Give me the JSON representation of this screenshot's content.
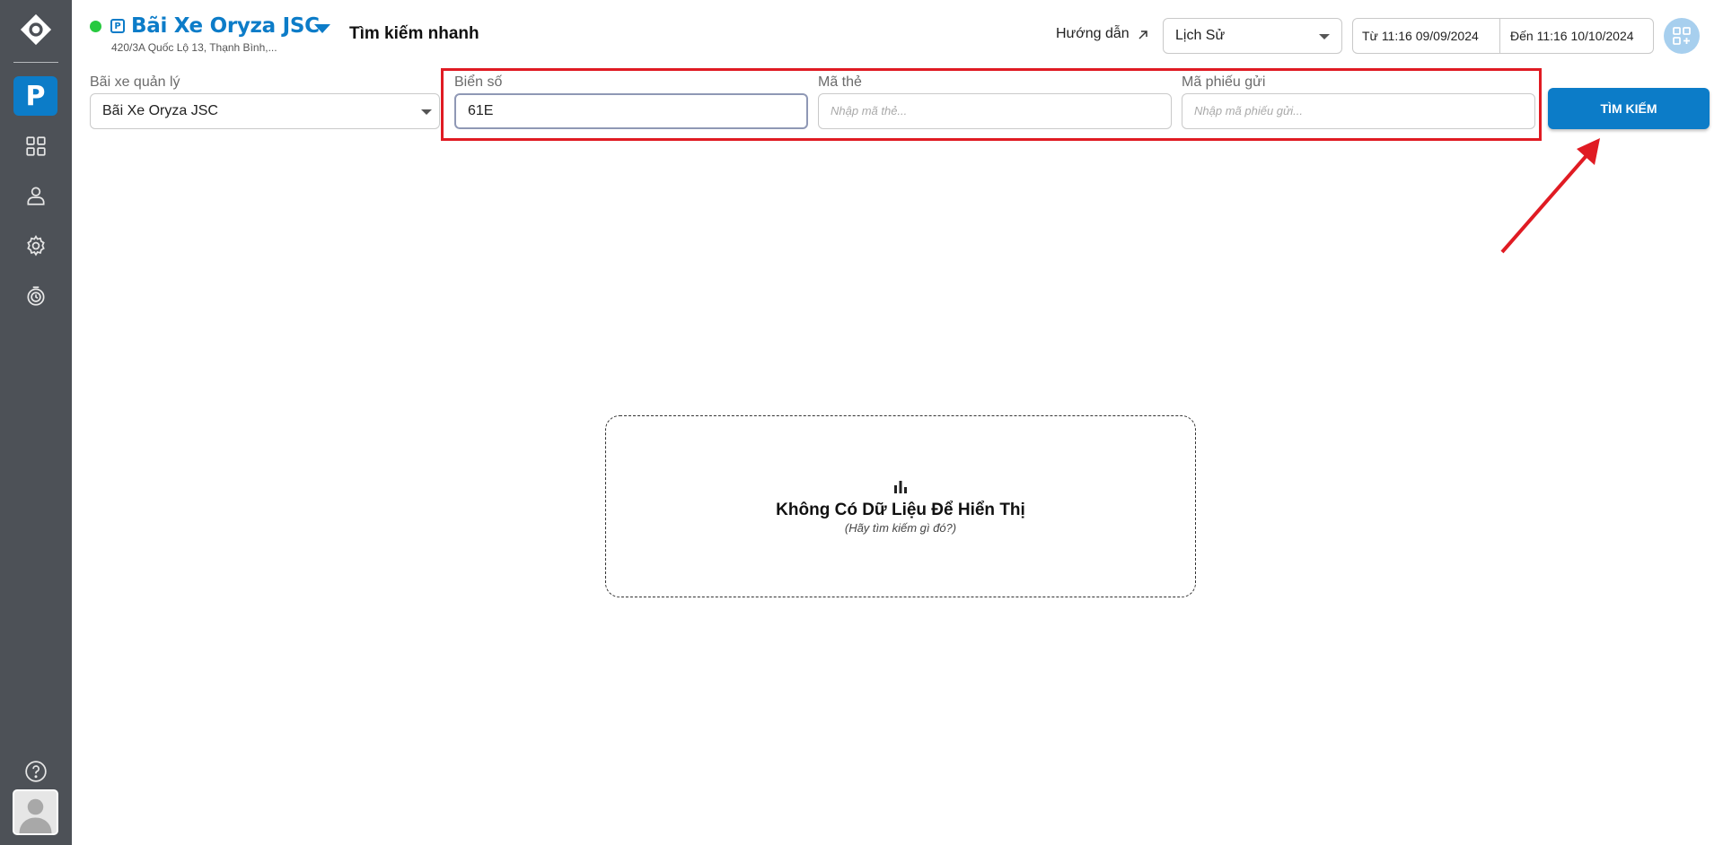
{
  "sidebar": {
    "logo": "logo-icon",
    "active_item": "P",
    "items": [
      "dashboard-grid-icon",
      "user-icon",
      "settings-gear-icon",
      "history-clock-icon"
    ],
    "help": "help-icon",
    "avatar": "avatar-icon"
  },
  "header": {
    "lot_name": "Bãi Xe Oryza JSC",
    "lot_address": "420/3A Quốc Lộ 13, Thạnh Bình,...",
    "page_title": "Tìm kiếm nhanh",
    "guide_label": "Hướng dẫn",
    "mode_select": "Lịch Sử",
    "date_from": "Từ 11:16 09/09/2024",
    "date_to": "Đến 11:16 10/10/2024"
  },
  "filters": {
    "lot_label": "Bãi xe quản lý",
    "lot_value": "Bãi Xe Oryza JSC",
    "plate_label": "Biển số",
    "plate_value": "61E",
    "card_label": "Mã thẻ",
    "card_placeholder": "Nhập mã thẻ...",
    "ticket_label": "Mã phiếu gửi",
    "ticket_placeholder": "Nhập mã phiếu gửi...",
    "search_button": "TÌM KIẾM"
  },
  "empty_state": {
    "title": "Không Có Dữ Liệu Để Hiển Thị",
    "subtitle": "(Hãy tìm kiếm gì đó?)"
  },
  "colors": {
    "accent": "#0c7cc8",
    "sidebar": "#4d5157",
    "highlight": "#e01b23"
  }
}
